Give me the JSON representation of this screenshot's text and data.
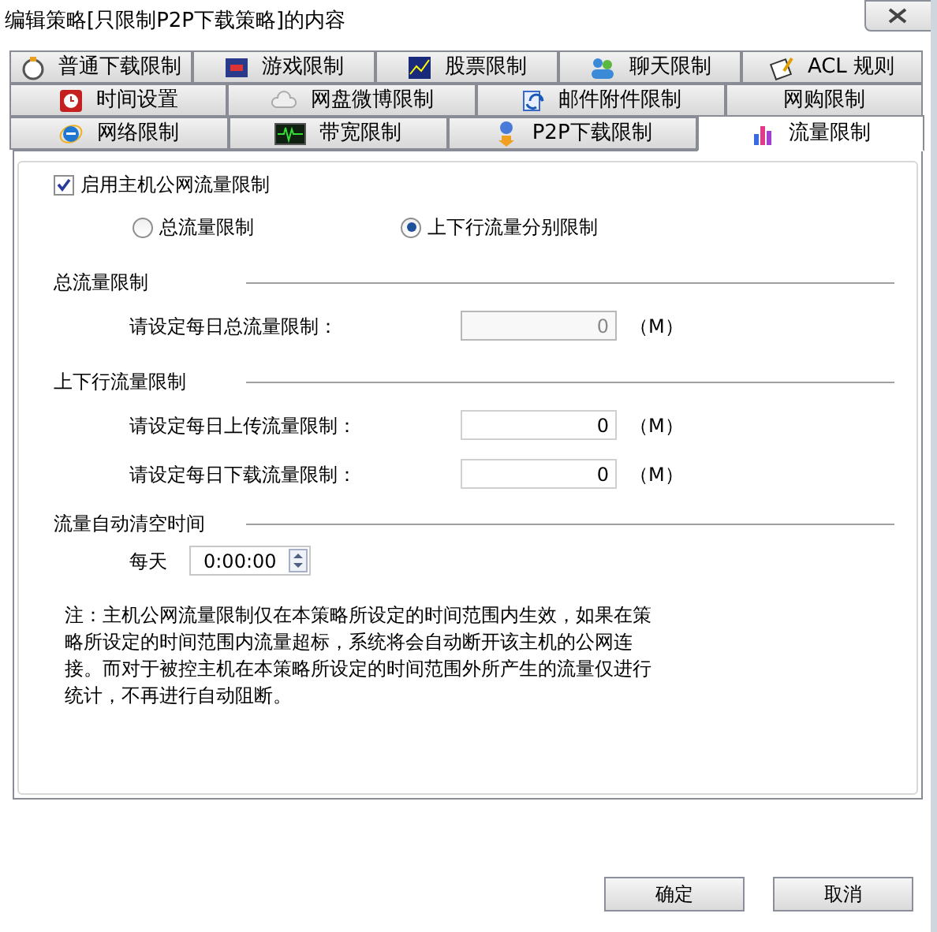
{
  "window": {
    "title": "编辑策略[只限制P2P下载策略]的内容"
  },
  "tab_rows": [
    [
      {
        "label": "普通下载限制",
        "selected": false
      },
      {
        "label": "游戏限制",
        "selected": false
      },
      {
        "label": "股票限制",
        "selected": false
      },
      {
        "label": "聊天限制",
        "selected": false
      },
      {
        "label": "ACL 规则",
        "selected": false
      }
    ],
    [
      {
        "label": "时间设置",
        "selected": false
      },
      {
        "label": "网盘微博限制",
        "selected": false
      },
      {
        "label": "邮件附件限制",
        "selected": false
      },
      {
        "label": "网购限制",
        "selected": false
      }
    ],
    [
      {
        "label": "网络限制",
        "selected": false
      },
      {
        "label": "带宽限制",
        "selected": false
      },
      {
        "label": "P2P下载限制",
        "selected": false
      },
      {
        "label": "流量限制",
        "selected": true
      }
    ]
  ],
  "enable": {
    "label": "启用主机公网流量限制",
    "checked": true
  },
  "mode_options": [
    {
      "label": "总流量限制",
      "selected": false
    },
    {
      "label": "上下行流量分别限制",
      "selected": true
    }
  ],
  "sections": [
    {
      "title": "总流量限制",
      "fields": [
        {
          "label": "请设定每日总流量限制：",
          "value": "0",
          "unit": "（M）",
          "disabled": true
        }
      ]
    },
    {
      "title": "上下行流量限制",
      "fields": [
        {
          "label": "请设定每日上传流量限制：",
          "value": "0",
          "unit": "（M）",
          "disabled": false
        },
        {
          "label": "请设定每日下载流量限制：",
          "value": "0",
          "unit": "（M）",
          "disabled": false
        }
      ]
    }
  ],
  "reset": {
    "title": "流量自动清空时间",
    "label": "每天",
    "value": "0:00:00"
  },
  "note": "注：主机公网流量限制仅在本策略所设定的时间范围内生效，如果在策略所设定的时间范围内流量超标，系统将会自动断开该主机的公网连接。而对于被控主机在本策略所设定的时间范围外所产生的流量仅进行统计，不再进行自动阻断。",
  "buttons": [
    "确定",
    "取消"
  ]
}
